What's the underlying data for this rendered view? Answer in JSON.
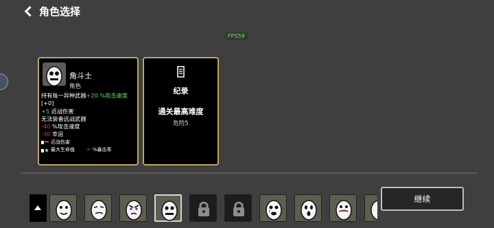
{
  "header": {
    "title": "角色选择"
  },
  "fps": "FPS59",
  "character": {
    "name": "角斗士",
    "type": "角色",
    "desc_line1_a": "持有每一异种武器",
    "desc_line1_b": "+20 %攻击速度",
    "desc_line2": "[+0]",
    "desc_line3_a": "+5",
    "desc_line3_b": " 近战伤害",
    "desc_line4": "无法装备远战武器",
    "desc_line5_a": "-40",
    "desc_line5_b": " %攻击速度",
    "desc_line6_a": "-30",
    "desc_line6_b": " 幸运",
    "small1": "近战伤害",
    "small2": "最大生命值",
    "small3": "%暴击率"
  },
  "record": {
    "title": "纪录",
    "subtitle": "通关最高难度",
    "danger": "危险5"
  },
  "continue_label": "继续",
  "tiles": [
    {
      "face": "smile",
      "locked": false,
      "selected": false
    },
    {
      "face": "sly",
      "locked": false,
      "selected": false
    },
    {
      "face": "angry",
      "locked": false,
      "selected": false
    },
    {
      "face": "gladiator",
      "locked": false,
      "selected": true
    },
    {
      "face": "lock",
      "locked": true,
      "selected": false
    },
    {
      "face": "lock",
      "locked": true,
      "selected": false
    },
    {
      "face": "cry",
      "locked": false,
      "selected": false
    },
    {
      "face": "shock",
      "locked": false,
      "selected": false
    },
    {
      "face": "mustache",
      "locked": false,
      "selected": false
    },
    {
      "face": "partial",
      "locked": false,
      "selected": false
    }
  ],
  "colors": {
    "card_border": "#b9a95c",
    "positive": "#54e15a",
    "negative": "#ef3b3b",
    "fps": "#6fe06f"
  }
}
